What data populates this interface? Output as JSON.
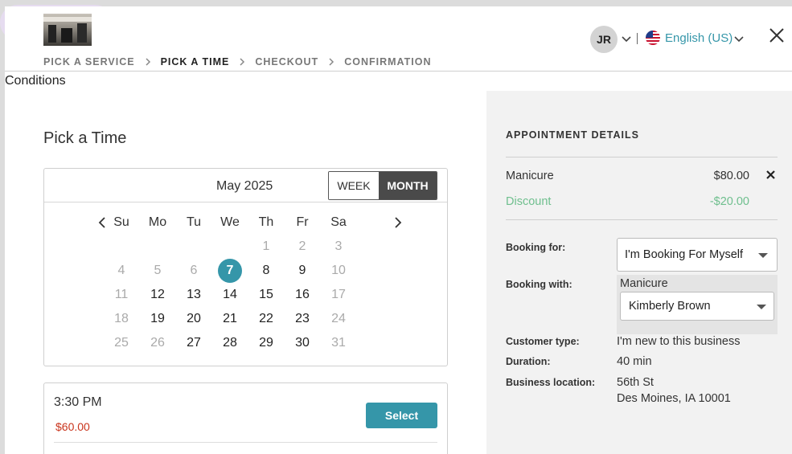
{
  "header": {
    "user_initials": "JR",
    "language": "English (US)"
  },
  "breadcrumb": [
    "PICK A SERVICE",
    "PICK A TIME",
    "CHECKOUT",
    "CONFIRMATION"
  ],
  "breadcrumb_active": 1,
  "conditions_label": "Conditions",
  "page_title": "Pick a Time",
  "calendar": {
    "month_label": "May 2025",
    "view_week": "WEEK",
    "view_month": "MONTH",
    "active_view": "MONTH",
    "weekdays": [
      "Su",
      "Mo",
      "Tu",
      "We",
      "Th",
      "Fr",
      "Sa"
    ],
    "selected_day": "7",
    "weeks": [
      [
        null,
        null,
        null,
        null,
        {
          "d": "1",
          "muted": true
        },
        {
          "d": "2",
          "muted": true
        },
        {
          "d": "3",
          "muted": true
        }
      ],
      [
        {
          "d": "4",
          "muted": true
        },
        {
          "d": "5",
          "muted": true
        },
        {
          "d": "6",
          "muted": true
        },
        {
          "d": "7",
          "selected": true
        },
        {
          "d": "8"
        },
        {
          "d": "9"
        },
        {
          "d": "10",
          "muted": true
        }
      ],
      [
        {
          "d": "11",
          "muted": true
        },
        {
          "d": "12"
        },
        {
          "d": "13"
        },
        {
          "d": "14"
        },
        {
          "d": "15"
        },
        {
          "d": "16"
        },
        {
          "d": "17",
          "muted": true
        }
      ],
      [
        {
          "d": "18",
          "muted": true
        },
        {
          "d": "19"
        },
        {
          "d": "20"
        },
        {
          "d": "21"
        },
        {
          "d": "22"
        },
        {
          "d": "23"
        },
        {
          "d": "24",
          "muted": true
        }
      ],
      [
        {
          "d": "25",
          "muted": true
        },
        {
          "d": "26",
          "muted": true
        },
        {
          "d": "27"
        },
        {
          "d": "28"
        },
        {
          "d": "29"
        },
        {
          "d": "30"
        },
        {
          "d": "31",
          "muted": true
        }
      ]
    ]
  },
  "time_slot": {
    "time": "3:30 PM",
    "price": "$60.00",
    "select_label": "Select"
  },
  "details": {
    "title": "APPOINTMENT DETAILS",
    "service_name": "Manicure",
    "service_price": "$80.00",
    "discount_label": "Discount",
    "discount_value": "-$20.00",
    "booking_for_label": "Booking for:",
    "booking_for_value": "I'm Booking For Myself",
    "booking_with_label": "Booking with:",
    "booking_with_service": "Manicure",
    "booking_with_staff": "Kimberly Brown",
    "customer_type_label": "Customer type:",
    "customer_type_value": "I'm new to this business",
    "duration_label": "Duration:",
    "duration_value": "40 min",
    "location_label": "Business location:",
    "location_line1": "56th St",
    "location_line2": "Des Moines, IA 10001"
  },
  "colors": {
    "accent": "#3596a9",
    "price_red": "#c9341c",
    "discount_green": "#6fbf8e",
    "toggle_active": "#4a4a4a"
  },
  "icons": [
    "chevron-down-icon",
    "us-flag-icon",
    "close-icon",
    "chevron-right-icon",
    "chevron-left-icon",
    "remove-x-icon",
    "caret-down-icon"
  ]
}
